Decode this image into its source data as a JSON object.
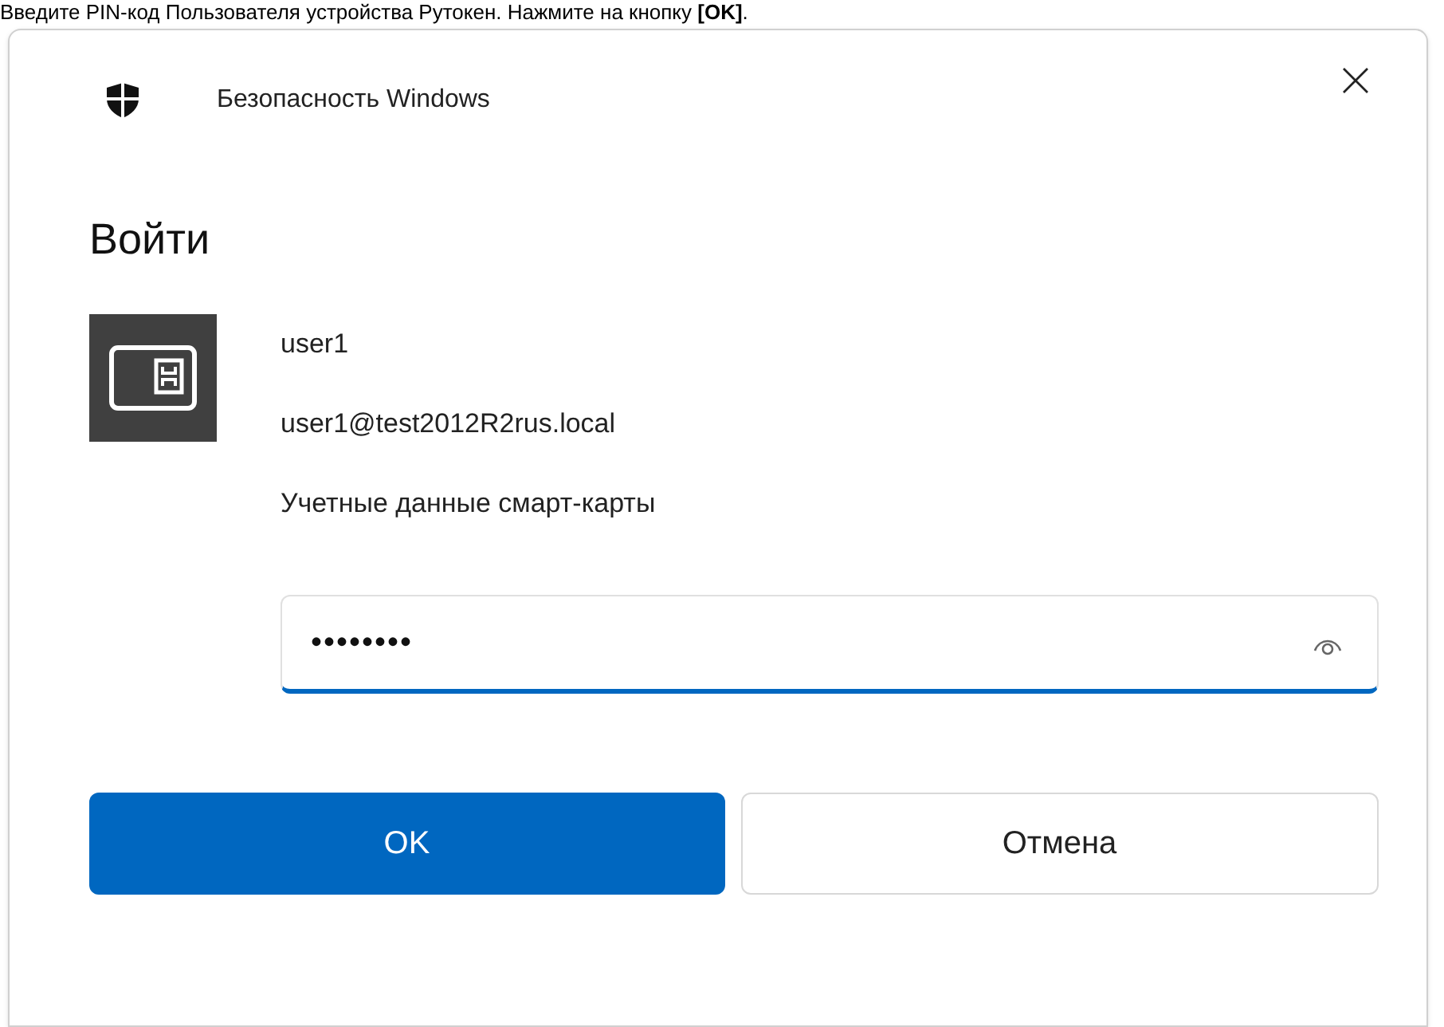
{
  "instruction": "Введите PIN-код Пользователя устройства Рутокен. Нажмите на кнопку **[OK]**.",
  "window": {
    "title": "Безопасность Windows"
  },
  "heading": "Войти",
  "account": {
    "name": "user1",
    "email": "user1@test2012R2rus.local",
    "credential_label": "Учетные данные смарт-карты"
  },
  "pin_field": {
    "value": "••••••••",
    "focused": true
  },
  "buttons": [
    {
      "label": "OK",
      "kind": "primary"
    },
    {
      "label": "Отмена",
      "kind": "secondary"
    }
  ]
}
